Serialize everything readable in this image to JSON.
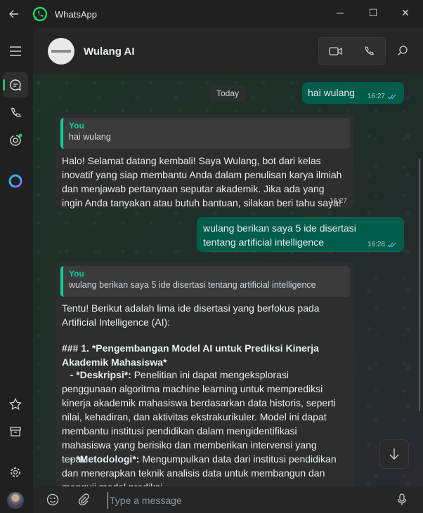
{
  "window": {
    "title": "WhatsApp",
    "controls": {
      "minimize": "─",
      "maximize": "☐",
      "close": "✕"
    }
  },
  "colors": {
    "accent": "#21c063",
    "outgoing_bubble": "#005c4b",
    "incoming_bubble": "#2e2e2e",
    "quote_accent": "#06cf9c"
  },
  "sidebar": {
    "items": [
      {
        "name": "menu-icon"
      },
      {
        "name": "chats-icon",
        "active": true
      },
      {
        "name": "calls-icon"
      },
      {
        "name": "status-icon"
      },
      {
        "name": "meta-ai-icon"
      },
      {
        "name": "starred-icon"
      },
      {
        "name": "archive-icon"
      },
      {
        "name": "settings-icon"
      },
      {
        "name": "profile-avatar"
      }
    ]
  },
  "header": {
    "contact_name": "Wulang AI",
    "buttons": [
      "video-call-icon",
      "voice-call-icon",
      "search-icon"
    ]
  },
  "chat": {
    "date_label": "Today",
    "messages": [
      {
        "direction": "out",
        "text": "hai wulang",
        "time": "16:27",
        "status": "read"
      },
      {
        "direction": "in",
        "quote_author": "You",
        "quote_text": "hai wulang",
        "text": "Halo! Selamat datang kembali! Saya Wulang, bot dari kelas inovatif yang siap membantu Anda dalam penulisan karya ilmiah dan menjawab pertanyaan seputar akademik. Jika ada yang ingin Anda tanyakan atau butuh bantuan, silakan beri tahu saya!",
        "time": "16:27"
      },
      {
        "direction": "out",
        "text": "wulang berikan saya 5 ide disertasi tentang artificial intelligence",
        "time": "16:28",
        "status": "read"
      },
      {
        "direction": "in",
        "quote_author": "You",
        "quote_text": "wulang berikan saya 5 ide disertasi tentang artificial intelligence",
        "text": "Tentu! Berikut adalah lima ide disertasi yang berfokus pada Artificial Intelligence (AI):",
        "heading": "### 1. *Pengembangan Model AI untuk Prediksi Kinerja Akademik Mahasiswa*",
        "bullet1_label": "- *Deskripsi*:",
        "bullet1_text": "Penelitian ini dapat mengeksplorasi penggunaan algoritma machine learning untuk memprediksi kinerja akademik mahasiswa berdasarkan data historis, seperti nilai, kehadiran, dan aktivitas ekstrakurikuler. Model ini dapat membantu institusi pendidikan dalam mengidentifikasi mahasiswa yang berisiko dan memberikan intervensi yang tepat.",
        "bullet2_label": "- *Metodologi*:",
        "bullet2_text": "Mengumpulkan data dari institusi pendidikan dan menerapkan teknik analisis data untuk membangun dan menguji model prediksi."
      }
    ]
  },
  "composer": {
    "placeholder": "Type a message",
    "value": ""
  }
}
